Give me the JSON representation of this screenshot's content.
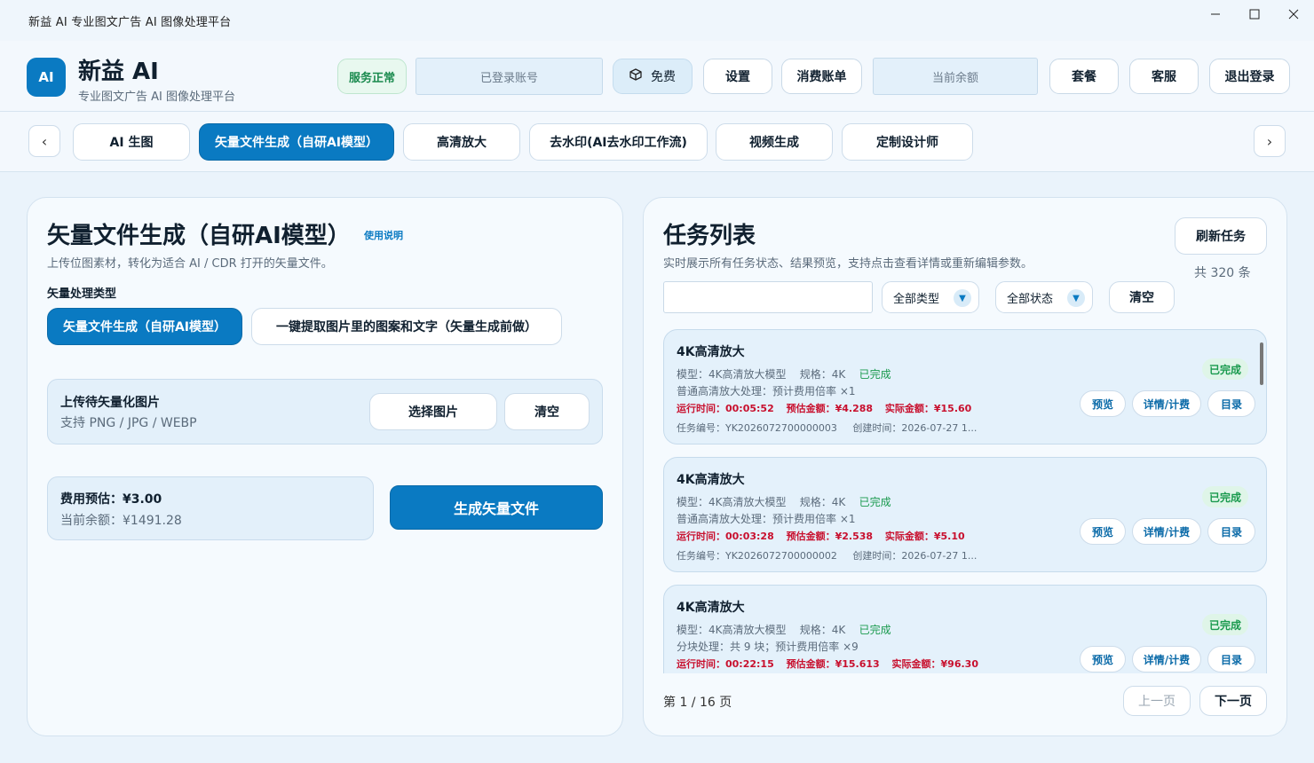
{
  "window": {
    "title": "新益 AI  专业图文广告 AI 图像处理平台",
    "minimize_icon": "minimize-icon",
    "maximize_icon": "maximize-icon",
    "close_icon": "close-icon"
  },
  "header": {
    "logo": "AI",
    "brand_name": "新益 AI",
    "brand_sub": "专业图文广告 AI 图像处理平台",
    "status": "服务正常",
    "account_placeholder": "已登录账号",
    "plan_label": "免费",
    "settings": "设置",
    "billing": "消费账单",
    "balance_placeholder": "当前余额",
    "package": "套餐",
    "support": "客服",
    "logout": "退出登录",
    "accent": "#0a7ac2"
  },
  "tabs": {
    "prev": "‹",
    "next": "›",
    "items": [
      "AI 生图",
      "矢量文件生成（自研AI模型）",
      "高清放大",
      "去水印(AI去水印工作流)",
      "视频生成",
      "定制设计师"
    ],
    "active_index": 1
  },
  "left": {
    "title": "矢量文件生成（自研AI模型）",
    "help": "使用说明",
    "subtitle": "上传位图素材，转化为适合 AI / CDR 打开的矢量文件。",
    "type_label": "矢量处理类型",
    "type_options": [
      "矢量文件生成（自研AI模型）",
      "一键提取图片里的图案和文字（矢量生成前做）"
    ],
    "upload_title": "上传待矢量化图片",
    "upload_sub": "支持 PNG / JPG / WEBP",
    "choose_btn": "选择图片",
    "clear_btn": "清空",
    "cost_estimate": "费用预估：¥3.00",
    "current_balance": "当前余额：¥1491.28",
    "generate_btn": "生成矢量文件"
  },
  "right": {
    "title": "任务列表",
    "subtitle": "实时展示所有任务状态、结果预览，支持点击查看详情或重新编辑参数。",
    "refresh_btn": "刷新任务",
    "total": "共 320 条",
    "search_value": "",
    "type_filter": "全部类型",
    "status_filter": "全部状态",
    "clear_btn": "清空",
    "tasks": [
      {
        "name": "4K高清放大",
        "model": "模型：4K高清放大模型",
        "spec": "规格：4K",
        "status": "已完成",
        "process": "普通高清放大处理：预计费用倍率 ×1",
        "runtime": "运行时间：00:05:52",
        "estimate": "预估金额：¥4.288",
        "actual": "实际金额：¥15.60",
        "task_id": "任务编号：YK2026072700000003",
        "created": "创建时间：2026-07-27 1...",
        "badge": "已完成",
        "btn_preview": "预览",
        "btn_detail": "详情/计费",
        "btn_dir": "目录"
      },
      {
        "name": "4K高清放大",
        "model": "模型：4K高清放大模型",
        "spec": "规格：4K",
        "status": "已完成",
        "process": "普通高清放大处理：预计费用倍率 ×1",
        "runtime": "运行时间：00:03:28",
        "estimate": "预估金额：¥2.538",
        "actual": "实际金额：¥5.10",
        "task_id": "任务编号：YK2026072700000002",
        "created": "创建时间：2026-07-27 1...",
        "badge": "已完成",
        "btn_preview": "预览",
        "btn_detail": "详情/计费",
        "btn_dir": "目录"
      },
      {
        "name": "4K高清放大",
        "model": "模型：4K高清放大模型",
        "spec": "规格：4K",
        "status": "已完成",
        "process": "分块处理：共 9 块；预计费用倍率 ×9",
        "runtime": "运行时间：00:22:15",
        "estimate": "预估金额：¥15.613",
        "actual": "实际金额：¥96.30",
        "task_id": "",
        "created": "",
        "badge": "已完成",
        "btn_preview": "预览",
        "btn_detail": "详情/计费",
        "btn_dir": "目录"
      }
    ],
    "page_info": "第 1 / 16 页",
    "prev_page": "上一页",
    "next_page": "下一页"
  }
}
